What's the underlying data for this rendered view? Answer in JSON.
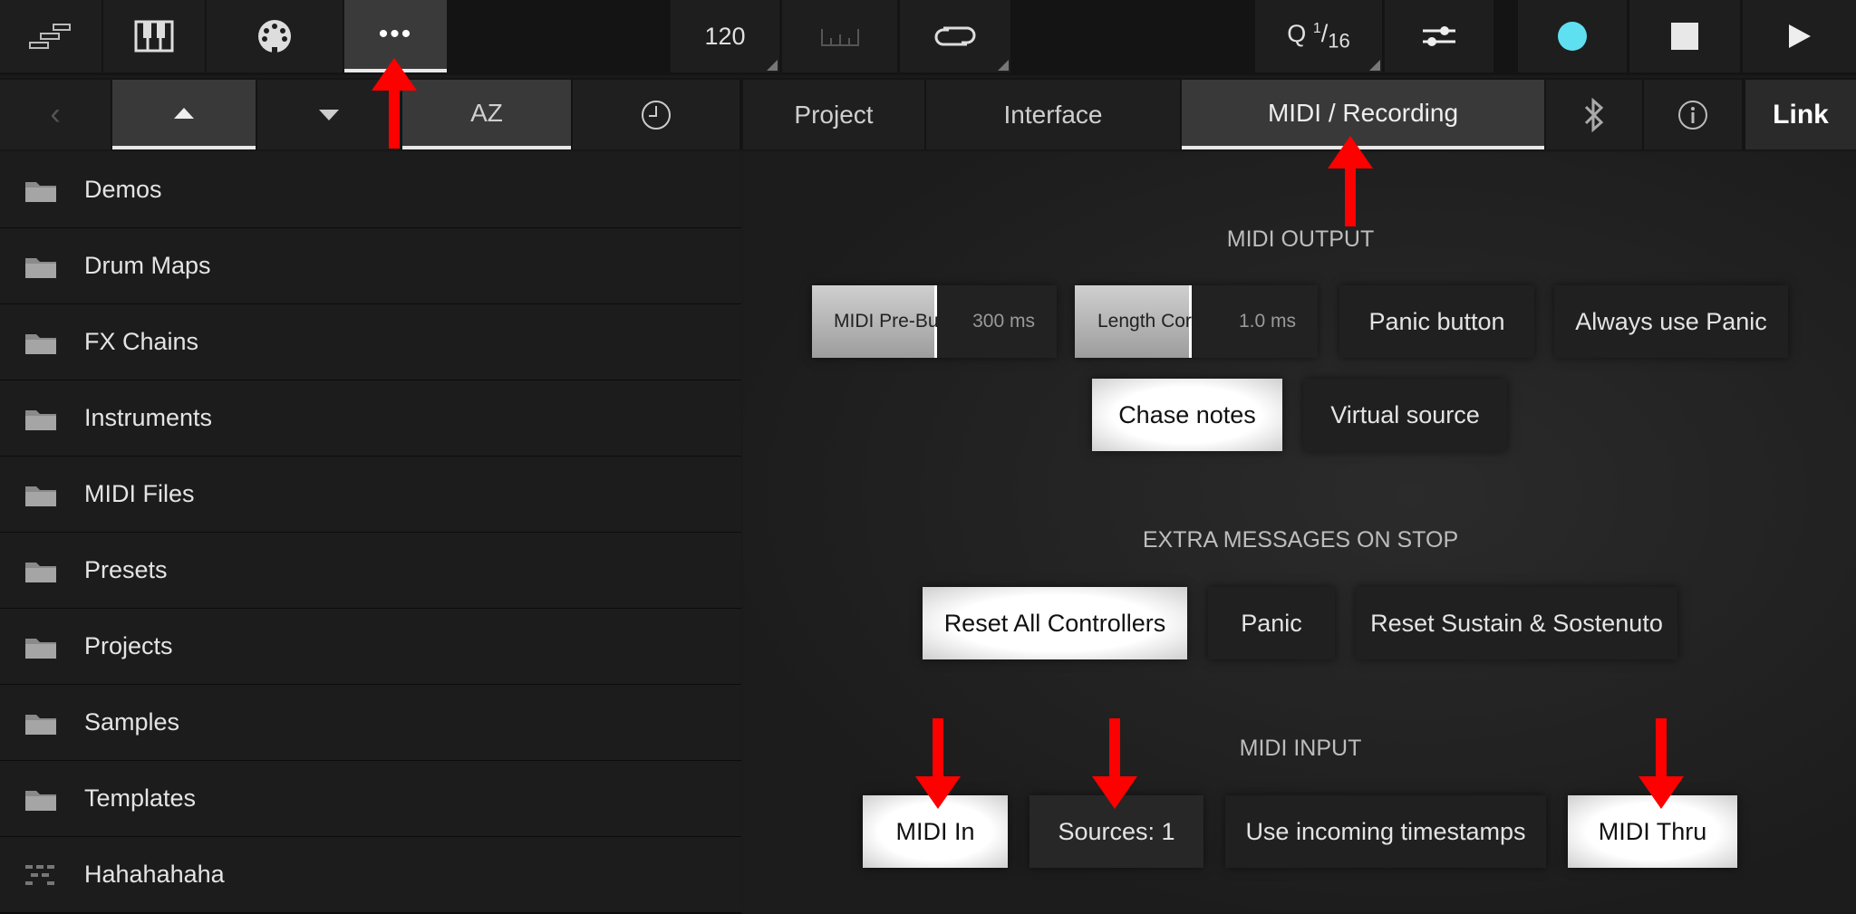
{
  "toolbar": {
    "tempo": "120",
    "quantize_q": "Q",
    "quantize_num": "1",
    "quantize_den": "16",
    "record_color": "#5fe0f0"
  },
  "nav": {
    "sort_label": "AZ",
    "tabs": [
      {
        "label": "Project"
      },
      {
        "label": "Interface"
      },
      {
        "label": "MIDI / Recording"
      }
    ],
    "link_label": "Link"
  },
  "files": [
    {
      "name": "Demos",
      "icon": "folder-icon"
    },
    {
      "name": "Drum Maps",
      "icon": "folder-icon"
    },
    {
      "name": "FX Chains",
      "icon": "folder-icon"
    },
    {
      "name": "Instruments",
      "icon": "folder-icon"
    },
    {
      "name": "MIDI Files",
      "icon": "folder-icon"
    },
    {
      "name": "Presets",
      "icon": "folder-icon"
    },
    {
      "name": "Projects",
      "icon": "folder-icon"
    },
    {
      "name": "Samples",
      "icon": "folder-icon"
    },
    {
      "name": "Templates",
      "icon": "folder-icon"
    },
    {
      "name": "Hahahahaha",
      "icon": "pattern-file-icon"
    }
  ],
  "midi_output": {
    "title": "MIDI OUTPUT",
    "pre_buffer_label": "MIDI Pre-Buffer",
    "pre_buffer_value": "300 ms",
    "pre_buffer_level": 0.5,
    "length_correction_label": "Length Correction",
    "length_correction_value": "1.0 ms",
    "length_correction_level": 0.47,
    "panic_button": "Panic button",
    "always_use_panic": "Always use Panic",
    "chase_notes": "Chase notes",
    "virtual_source": "Virtual source"
  },
  "extra_messages": {
    "title": "EXTRA MESSAGES ON STOP",
    "reset_all_controllers": "Reset All Controllers",
    "panic": "Panic",
    "reset_sustain": "Reset Sustain & Sostenuto"
  },
  "midi_input": {
    "title": "MIDI INPUT",
    "midi_in": "MIDI In",
    "sources": "Sources: 1",
    "use_incoming_timestamps": "Use incoming timestamps",
    "midi_thru": "MIDI Thru"
  },
  "annotation_color": "#ff0000"
}
